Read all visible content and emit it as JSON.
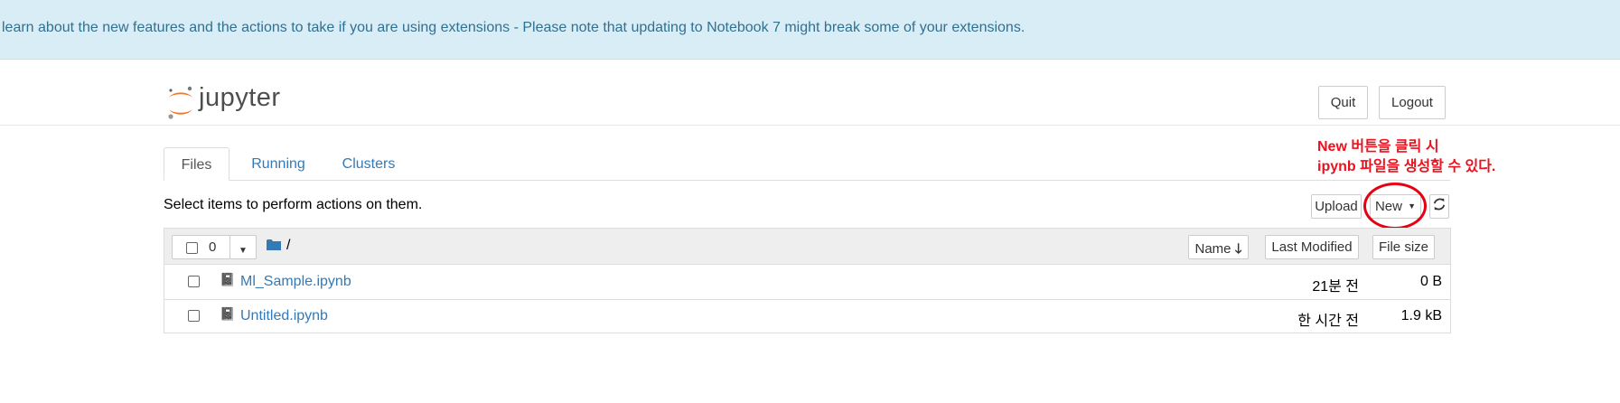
{
  "banner": {
    "text": "learn about the new features and the actions to take if you are using extensions - Please note that updating to Notebook 7 might break some of your extensions."
  },
  "header": {
    "logo_text": "jupyter",
    "quit_label": "Quit",
    "logout_label": "Logout"
  },
  "tabs": [
    {
      "label": "Files",
      "active": true
    },
    {
      "label": "Running",
      "active": false
    },
    {
      "label": "Clusters",
      "active": false
    }
  ],
  "toolbar": {
    "select_message": "Select items to perform actions on them.",
    "upload_label": "Upload",
    "new_label": "New",
    "refresh_icon": "refresh-icon"
  },
  "annotation": {
    "line1": "New 버튼을 클릭 시",
    "line2": "ipynb 파일을 생성할 수 있다."
  },
  "list_header": {
    "selected_count": "0",
    "path": "/",
    "col_name": "Name",
    "col_modified": "Last Modified",
    "col_size": "File size"
  },
  "files": [
    {
      "name": "Ml_Sample.ipynb",
      "modified": "21분 전",
      "size": "0 B"
    },
    {
      "name": "Untitled.ipynb",
      "modified": "한 시간 전",
      "size": "1.9 kB"
    }
  ],
  "colors": {
    "banner_bg": "#d9edf7",
    "link": "#337ab7",
    "annotation_red": "#e8131f",
    "jupyter_orange": "#f37726"
  }
}
